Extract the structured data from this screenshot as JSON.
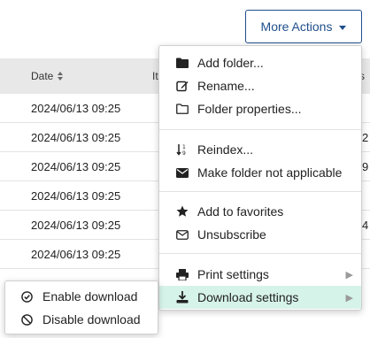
{
  "actions_button": {
    "label": "More Actions"
  },
  "table": {
    "headers": {
      "date": "Date",
      "partial_col": "It",
      "partial_right": "s"
    },
    "rows": [
      {
        "date": "2024/06/13 09:25",
        "edge": ""
      },
      {
        "date": "2024/06/13 09:25",
        "edge": "2"
      },
      {
        "date": "2024/06/13 09:25",
        "edge": "9"
      },
      {
        "date": "2024/06/13 09:25",
        "edge": ""
      },
      {
        "date": "2024/06/13 09:25",
        "edge": "4"
      },
      {
        "date": "2024/06/13 09:25",
        "edge": ""
      }
    ]
  },
  "menu": {
    "items": [
      {
        "label": "Add folder...",
        "icon": "folder-icon"
      },
      {
        "label": "Rename...",
        "icon": "edit-icon"
      },
      {
        "label": "Folder properties...",
        "icon": "folder-outline-icon"
      },
      {
        "label": "Reindex...",
        "icon": "sort-numeric-icon"
      },
      {
        "label": "Make folder not applicable",
        "icon": "envelope-icon"
      },
      {
        "label": "Add to favorites",
        "icon": "star-icon"
      },
      {
        "label": "Unsubscribe",
        "icon": "envelope-outline-icon"
      },
      {
        "label": "Print settings",
        "icon": "print-icon"
      },
      {
        "label": "Download settings",
        "icon": "download-icon"
      }
    ]
  },
  "submenu": {
    "items": [
      {
        "label": "Enable download",
        "icon": "check-circle-icon"
      },
      {
        "label": "Disable download",
        "icon": "ban-icon"
      }
    ]
  },
  "colors": {
    "accent": "#1f4e8c",
    "active_bg": "#d6f3ea",
    "header_bg": "#e8e8e8"
  }
}
